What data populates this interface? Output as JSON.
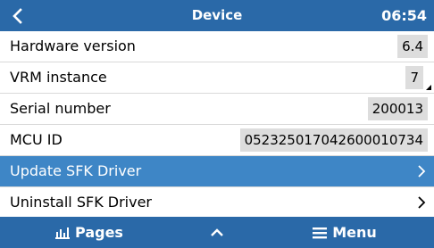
{
  "header": {
    "title": "Device",
    "clock": "06:54",
    "back_icon": "chevron-left-icon"
  },
  "rows": [
    {
      "label": "Hardware version",
      "value": "6.4"
    },
    {
      "label": "VRM instance",
      "value": "7"
    },
    {
      "label": "Serial number",
      "value": "200013"
    },
    {
      "label": "MCU ID",
      "value": "05232501704260001073​4"
    },
    {
      "label": "Update SFK Driver",
      "selected": true
    },
    {
      "label": "Uninstall SFK Driver"
    }
  ],
  "footer": {
    "pages_label": "Pages",
    "pages_icon": "bar-chart-icon",
    "up_icon": "chevron-up-icon",
    "menu_label": "Menu",
    "menu_icon": "hamburger-icon"
  },
  "colors": {
    "bar": "#2a69a8",
    "selected": "#3e86c6",
    "value_bg": "#dddddd"
  }
}
